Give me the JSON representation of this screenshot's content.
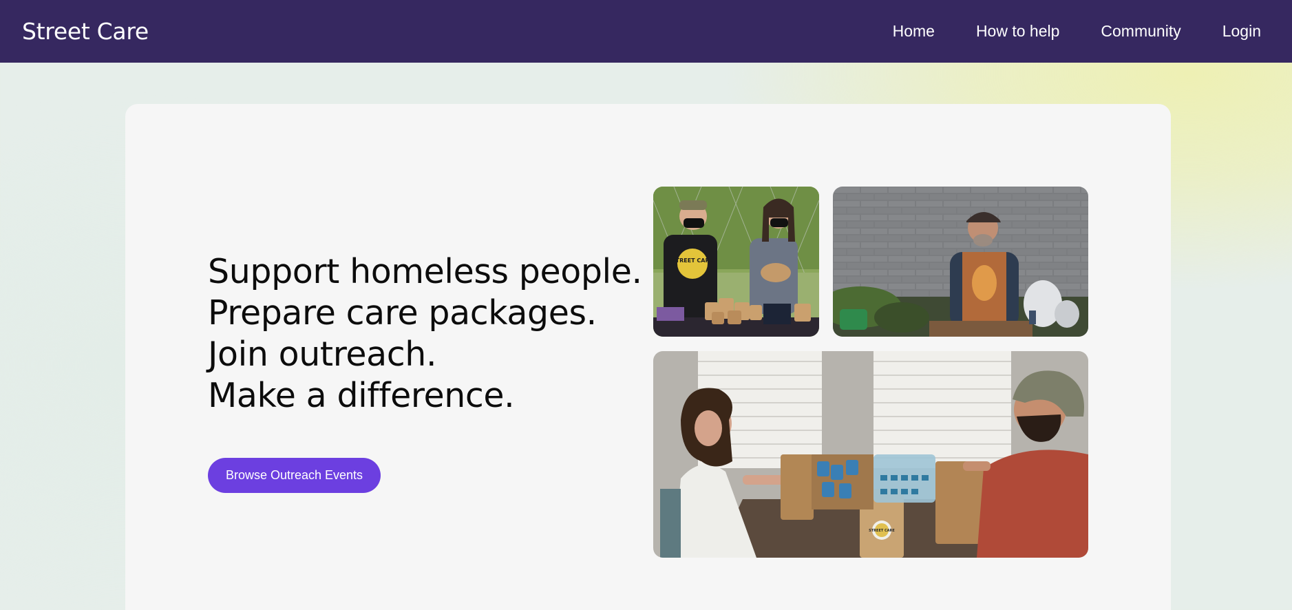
{
  "navbar": {
    "brand": "Street Care",
    "links": [
      "Home",
      "How to help",
      "Community",
      "Login"
    ]
  },
  "hero": {
    "headline_lines": [
      "Support homeless people.",
      "Prepare care packages.",
      "Join outreach.",
      "Make a difference."
    ],
    "cta_label": "Browse Outreach Events"
  },
  "photos": [
    {
      "label": "photo-volunteers-with-care-packages",
      "badge_text": "STREET CARE"
    },
    {
      "label": "photo-man-sitting-by-brick-wall"
    },
    {
      "label": "photo-packing-care-packages-at-table",
      "badge_text": "STREET CARE"
    }
  ],
  "colors": {
    "navbar": "#362860",
    "cta": "#6c3fe0",
    "card": "#f6f6f6"
  }
}
